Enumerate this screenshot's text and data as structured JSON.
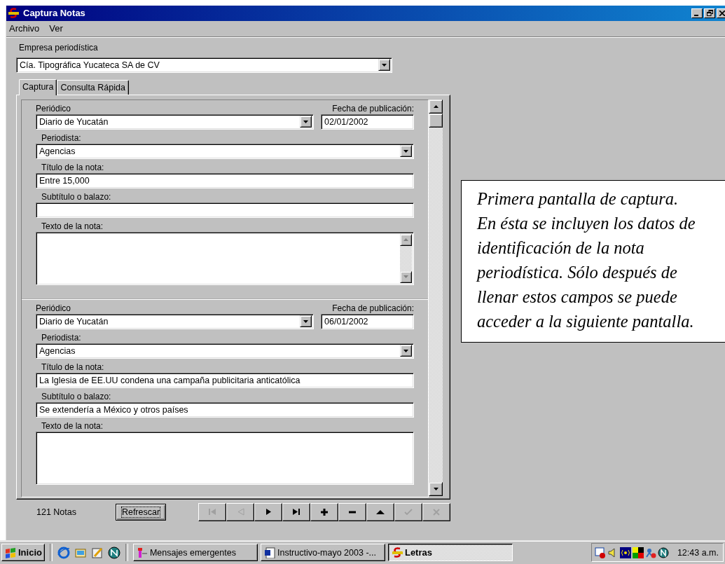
{
  "window": {
    "title": "Captura Notas"
  },
  "menu": [
    {
      "label": "Archivo"
    },
    {
      "label": "Ver"
    }
  ],
  "company": {
    "label": "Empresa periodística",
    "value": "Cía. Tipográfica Yucateca SA de CV"
  },
  "tabs": [
    {
      "label": "Captura",
      "selected": true
    },
    {
      "label": "Consulta Rápida",
      "selected": false
    }
  ],
  "records": [
    {
      "newspaper_label": "Periódico",
      "newspaper": "Diario de Yucatán",
      "date_label": "Fecha de publicación:",
      "date": "02/01/2002",
      "journalist_label": "Periodista:",
      "journalist": "Agencias",
      "title_label": "Título de la nota:",
      "title": "Entre 15,000",
      "subtitle_label": "Subtítulo o balazo:",
      "text_label": "Texto de la nota:",
      "text_scrollbar": true
    },
    {
      "newspaper_label": "Periódico",
      "newspaper": "Diario de Yucatán",
      "date_label": "Fecha de publicación:",
      "date": "06/01/2002",
      "journalist_label": "Periodista:",
      "journalist": "Agencias",
      "title_label": "Título de la nota:",
      "title": "La Iglesia de EE.UU condena una campaña publicitaria anticatólica",
      "subtitle_label": "Subtítulo o balazo:",
      "subtitle": "Se extendería a México y otros países",
      "text_label": "Texto de la nota:",
      "text_scrollbar": false
    }
  ],
  "footer": {
    "count": "121 Notas",
    "refresh": {
      "label": "Refrescar",
      "focused": true
    },
    "nav": [
      {
        "kind": "first",
        "disabled": true
      },
      {
        "kind": "prev",
        "disabled": true
      },
      {
        "kind": "next",
        "disabled": false
      },
      {
        "kind": "last",
        "disabled": false
      },
      {
        "kind": "add",
        "disabled": false
      },
      {
        "kind": "remove",
        "disabled": false
      },
      {
        "kind": "up",
        "disabled": false
      },
      {
        "kind": "accept",
        "disabled": true
      },
      {
        "kind": "cancel",
        "disabled": true
      }
    ]
  },
  "callout": {
    "text": "Primera pantalla de captura. En ésta se incluyen los datos de identificación de la nota periodística. Sólo después de llenar estos campos se puede acceder a la siguiente pantalla."
  },
  "taskbar": {
    "start": "Inicio",
    "tasks": [
      {
        "label": "Mensajes emergentes",
        "selected": false
      },
      {
        "label": "Instructivo-mayo 2003 -...",
        "selected": false
      },
      {
        "label": "Letras",
        "selected": true
      }
    ],
    "clock": "12:43 a.m."
  }
}
